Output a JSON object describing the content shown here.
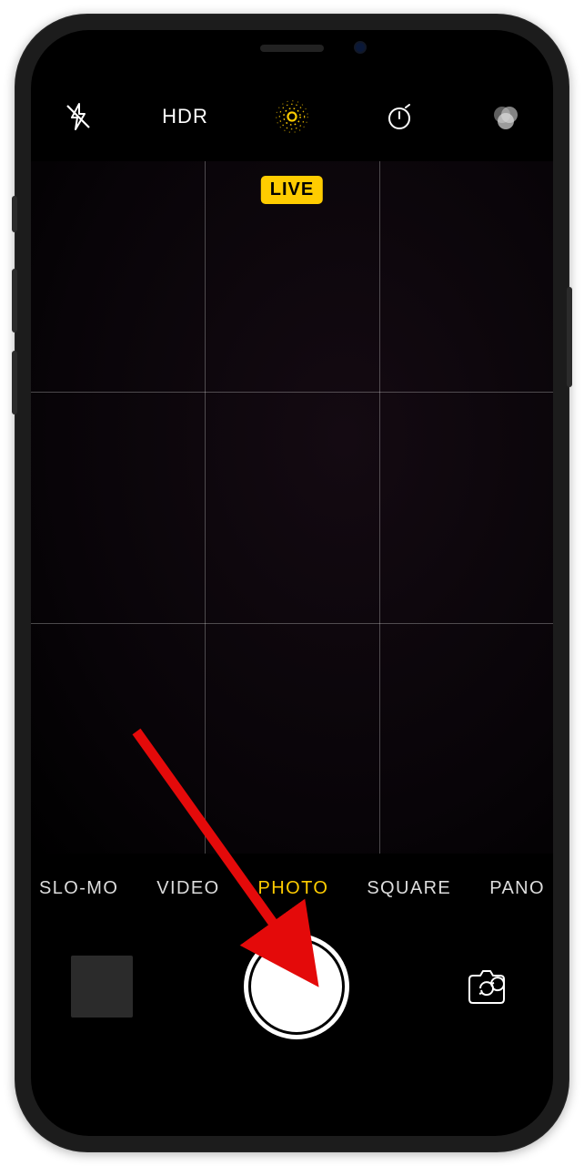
{
  "toolbar": {
    "hdr_label": "HDR"
  },
  "live_badge": "LIVE",
  "modes": {
    "slo_mo": "SLO-MO",
    "video": "VIDEO",
    "photo": "PHOTO",
    "square": "SQUARE",
    "pano": "PANO"
  },
  "colors": {
    "accent": "#ffcc00"
  }
}
